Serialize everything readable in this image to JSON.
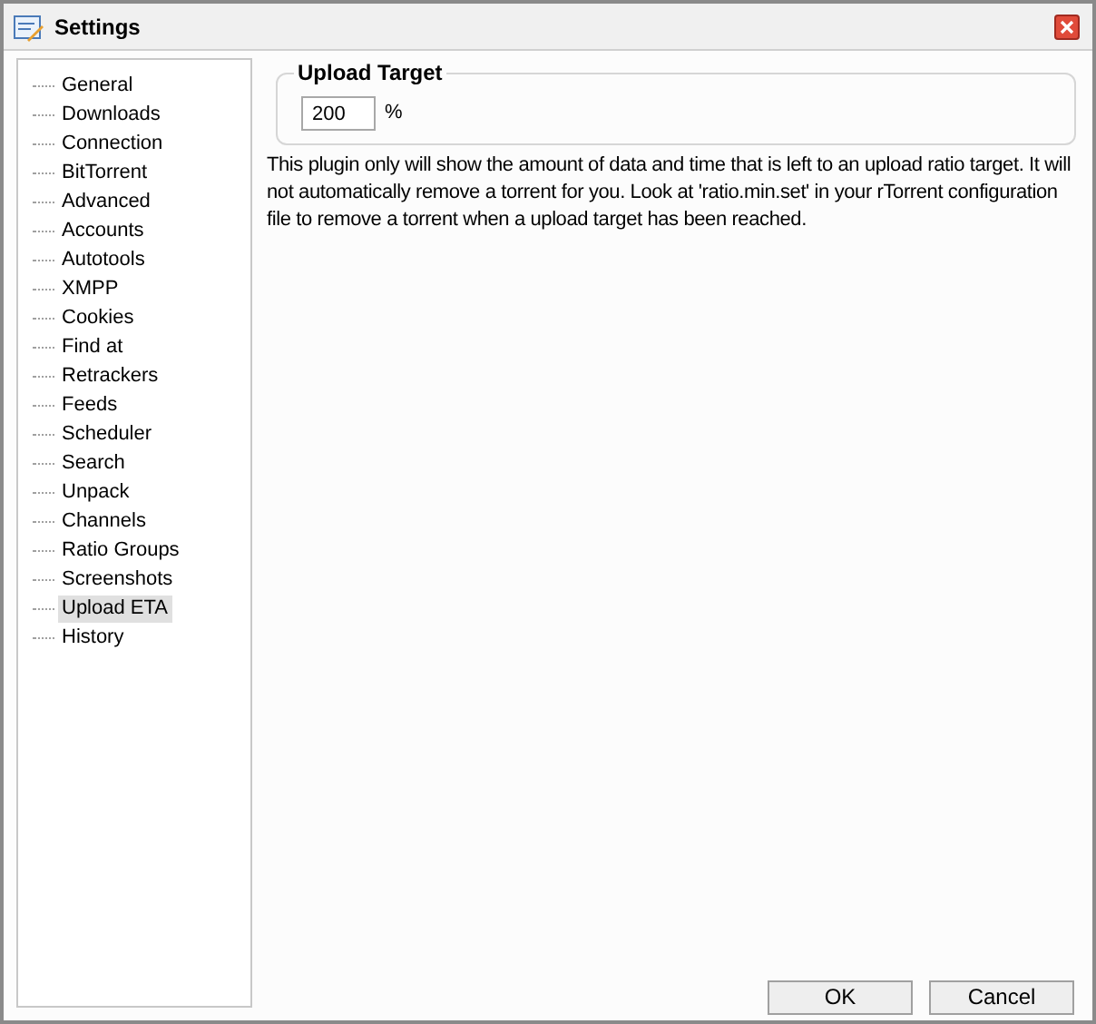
{
  "window": {
    "title": "Settings"
  },
  "sidebar": {
    "items": [
      {
        "label": "General",
        "selected": false
      },
      {
        "label": "Downloads",
        "selected": false
      },
      {
        "label": "Connection",
        "selected": false
      },
      {
        "label": "BitTorrent",
        "selected": false
      },
      {
        "label": "Advanced",
        "selected": false
      },
      {
        "label": "Accounts",
        "selected": false
      },
      {
        "label": "Autotools",
        "selected": false
      },
      {
        "label": "XMPP",
        "selected": false
      },
      {
        "label": "Cookies",
        "selected": false
      },
      {
        "label": "Find at",
        "selected": false
      },
      {
        "label": "Retrackers",
        "selected": false
      },
      {
        "label": "Feeds",
        "selected": false
      },
      {
        "label": "Scheduler",
        "selected": false
      },
      {
        "label": "Search",
        "selected": false
      },
      {
        "label": "Unpack",
        "selected": false
      },
      {
        "label": "Channels",
        "selected": false
      },
      {
        "label": "Ratio Groups",
        "selected": false
      },
      {
        "label": "Screenshots",
        "selected": false
      },
      {
        "label": "Upload ETA",
        "selected": true
      },
      {
        "label": "History",
        "selected": false
      }
    ]
  },
  "upload_target": {
    "legend": "Upload Target",
    "value": "200",
    "unit": "%"
  },
  "description": "This plugin only will show the amount of data and time that is left to an upload ratio target. It will not automatically remove a torrent for you. Look at 'ratio.min.set' in your rTorrent configuration file to remove a torrent when a upload target has been reached.",
  "buttons": [
    "OK",
    "Cancel"
  ]
}
